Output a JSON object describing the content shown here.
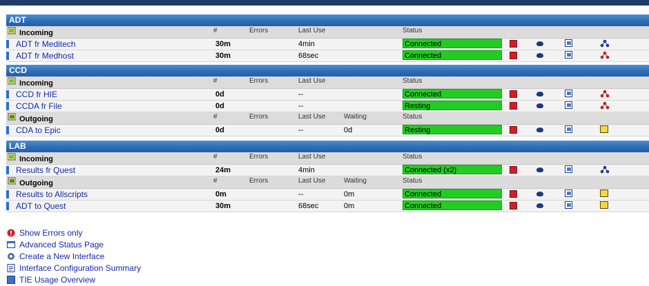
{
  "columns": {
    "count": "#",
    "errors": "Errors",
    "last_use": "Last Use",
    "waiting": "Waiting",
    "status": "Status"
  },
  "colors": {
    "status_green": "#22cc22",
    "header_blue": "#2c6ab3",
    "link_blue": "#1428a8",
    "stop_red": "#d01f2a"
  },
  "sections": [
    {
      "title": "ADT",
      "groups": [
        {
          "label": "Incoming",
          "rows": [
            {
              "name": "ADT fr Meditech",
              "count": "30m",
              "last_use": "4min",
              "status": "Connected",
              "icon": "tree"
            },
            {
              "name": "ADT fr Medhost",
              "count": "30m",
              "last_use": "68sec",
              "status": "Connected",
              "icon": "tree-red"
            }
          ]
        }
      ]
    },
    {
      "title": "CCD",
      "groups": [
        {
          "label": "Incoming",
          "rows": [
            {
              "name": "CCD fr HIE",
              "count": "0d",
              "last_use": "--",
              "status": "Connected",
              "icon": "tree-red"
            },
            {
              "name": "CCDA fr File",
              "count": "0d",
              "last_use": "--",
              "status": "Resting",
              "icon": "tree-red"
            }
          ]
        },
        {
          "label": "Outgoing",
          "rows": [
            {
              "name": "CDA to Epic",
              "count": "0d",
              "last_use": "--",
              "waiting": "0d",
              "status": "Resting",
              "icon": "doc"
            }
          ]
        }
      ]
    },
    {
      "title": "LAB",
      "groups": [
        {
          "label": "Incoming",
          "rows": [
            {
              "name": "Results fr Quest",
              "count": "24m",
              "last_use": "4min",
              "status": "Connected (x2)",
              "icon": "tree"
            }
          ]
        },
        {
          "label": "Outgoing",
          "rows": [
            {
              "name": "Results to Allscripts",
              "count": "0m",
              "last_use": "--",
              "waiting": "0m",
              "status": "Connected",
              "icon": "doc"
            },
            {
              "name": "ADT to Quest",
              "count": "30m",
              "last_use": "68sec",
              "waiting": "0m",
              "status": "Connected",
              "icon": "doc"
            }
          ]
        }
      ]
    }
  ],
  "links": [
    {
      "label": "Show Errors only",
      "icon": "error-icon"
    },
    {
      "label": "Advanced Status Page",
      "icon": "window-icon"
    },
    {
      "label": "Create a New Interface",
      "icon": "gear-icon"
    },
    {
      "label": "Interface Configuration Summary",
      "icon": "config-icon"
    },
    {
      "label": "TIE Usage Overview",
      "icon": "help-icon"
    }
  ]
}
